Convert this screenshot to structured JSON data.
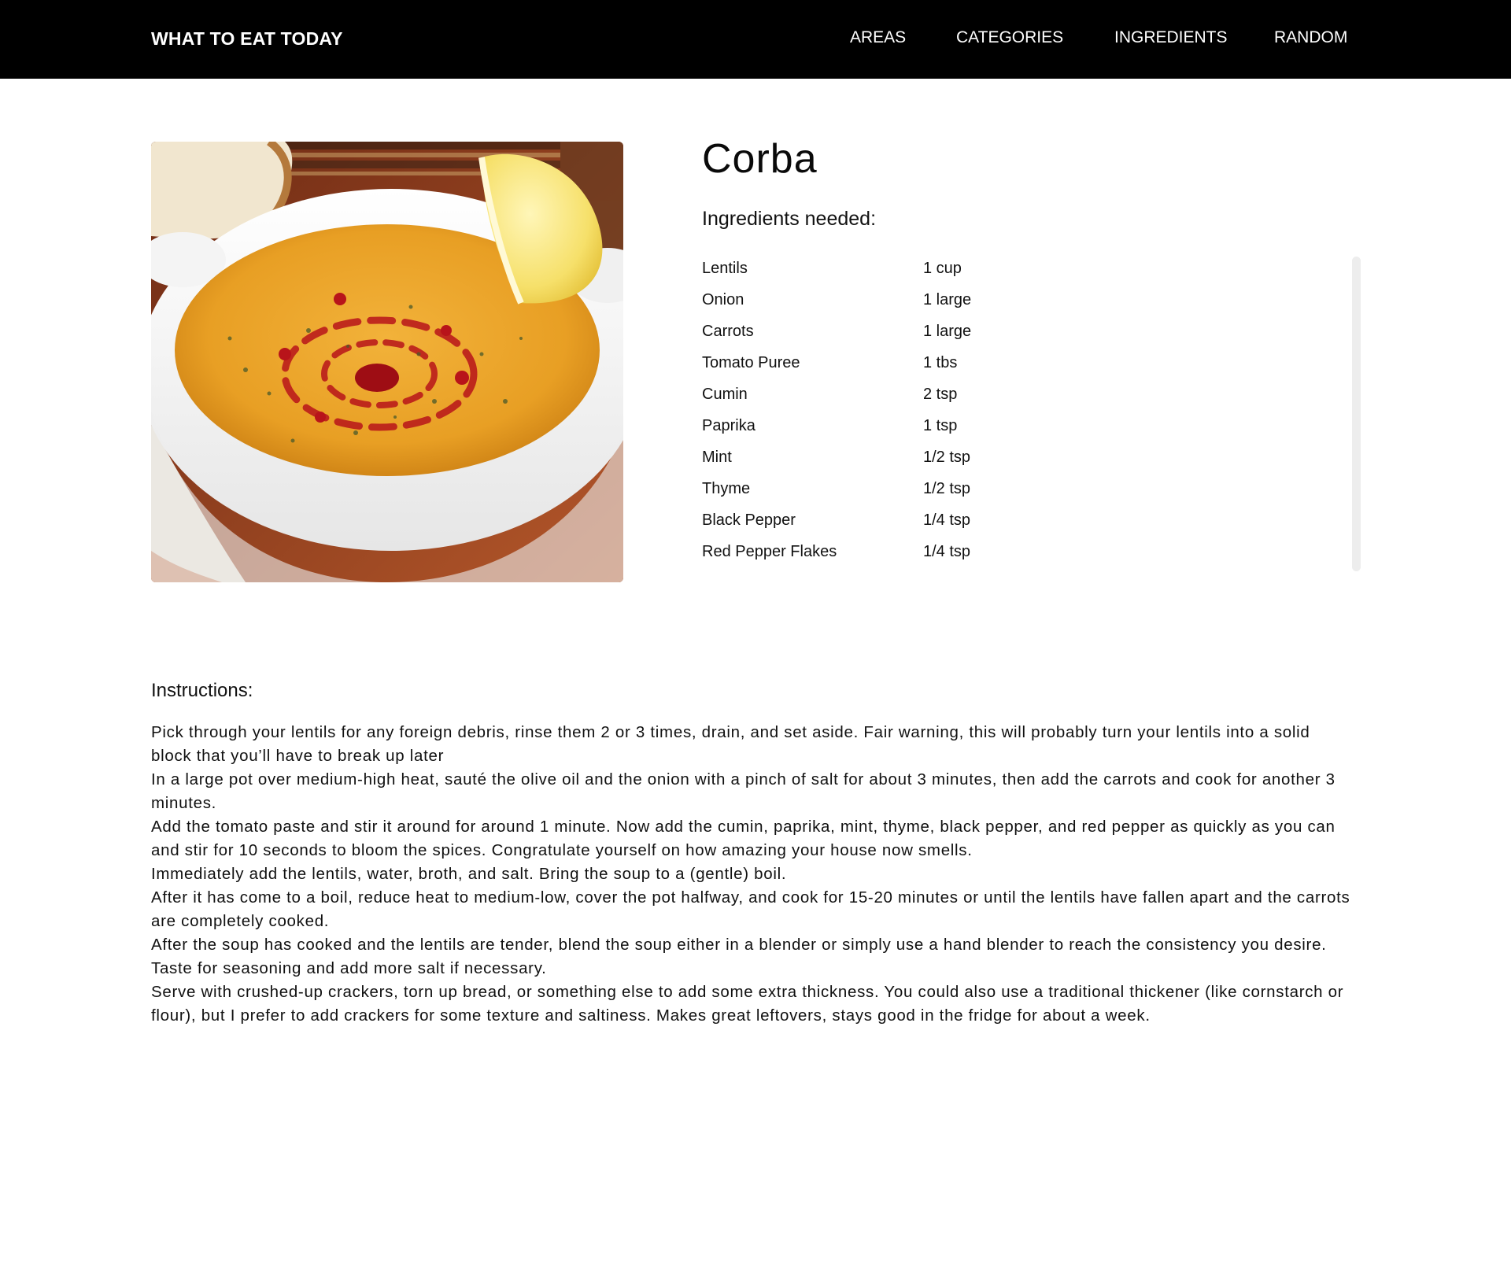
{
  "header": {
    "brand": "WHAT TO EAT TODAY",
    "nav": {
      "areas": "AREAS",
      "categories": "CATEGORIES",
      "ingredients": "INGREDIENTS",
      "random": "RANDOM"
    }
  },
  "meal": {
    "title": "Corba",
    "image_alt": "Corba",
    "ingredients_heading": "Ingredients needed:",
    "ingredients": [
      {
        "name": "Lentils",
        "measure": "1 cup"
      },
      {
        "name": "Onion",
        "measure": "1 large"
      },
      {
        "name": "Carrots",
        "measure": "1 large"
      },
      {
        "name": "Tomato Puree",
        "measure": "1 tbs"
      },
      {
        "name": "Cumin",
        "measure": "2 tsp"
      },
      {
        "name": "Paprika",
        "measure": "1 tsp"
      },
      {
        "name": "Mint",
        "measure": "1/2 tsp"
      },
      {
        "name": "Thyme",
        "measure": "1/2 tsp"
      },
      {
        "name": "Black Pepper",
        "measure": "1/4 tsp"
      },
      {
        "name": "Red Pepper Flakes",
        "measure": "1/4 tsp"
      }
    ],
    "instructions_heading": "Instructions:",
    "instructions": [
      "Pick through your lentils for any foreign debris, rinse them 2 or 3 times, drain, and set aside.  Fair warning, this will probably turn your lentils into a solid block that you’ll have to break up later",
      "In a large pot over medium-high heat, sauté the olive oil and the onion with a pinch of salt for about 3 minutes, then add the carrots and cook for another 3 minutes.",
      "Add the tomato paste and stir it around for around 1 minute. Now add the cumin, paprika, mint, thyme, black pepper, and red pepper as quickly as you can and stir for 10 seconds to bloom the spices. Congratulate yourself on how amazing your house now smells.",
      "Immediately add the lentils, water, broth, and salt. Bring the soup to a (gentle) boil.",
      "After it has come to a boil, reduce heat to medium-low, cover the pot halfway, and cook for 15-20 minutes or until the lentils have fallen apart and the carrots are completely cooked.",
      "After the soup has cooked and the lentils are tender, blend the soup either in a blender or simply use a hand blender to reach the consistency you desire. Taste for seasoning and add more salt if necessary.",
      "Serve with crushed-up crackers, torn up bread, or something else to add some extra thickness.  You could also use a traditional thickener (like cornstarch or flour), but I prefer to add crackers for some texture and saltiness.  Makes great leftovers, stays good in the fridge for about a week."
    ]
  },
  "colors": {
    "header_bg": "#000000",
    "header_text": "#ffffff",
    "page_bg": "#ffffff",
    "text": "#111111",
    "scrollbar_track": "#ededed"
  },
  "icons": {
    "meal_photo": "lentil-soup-photo"
  }
}
